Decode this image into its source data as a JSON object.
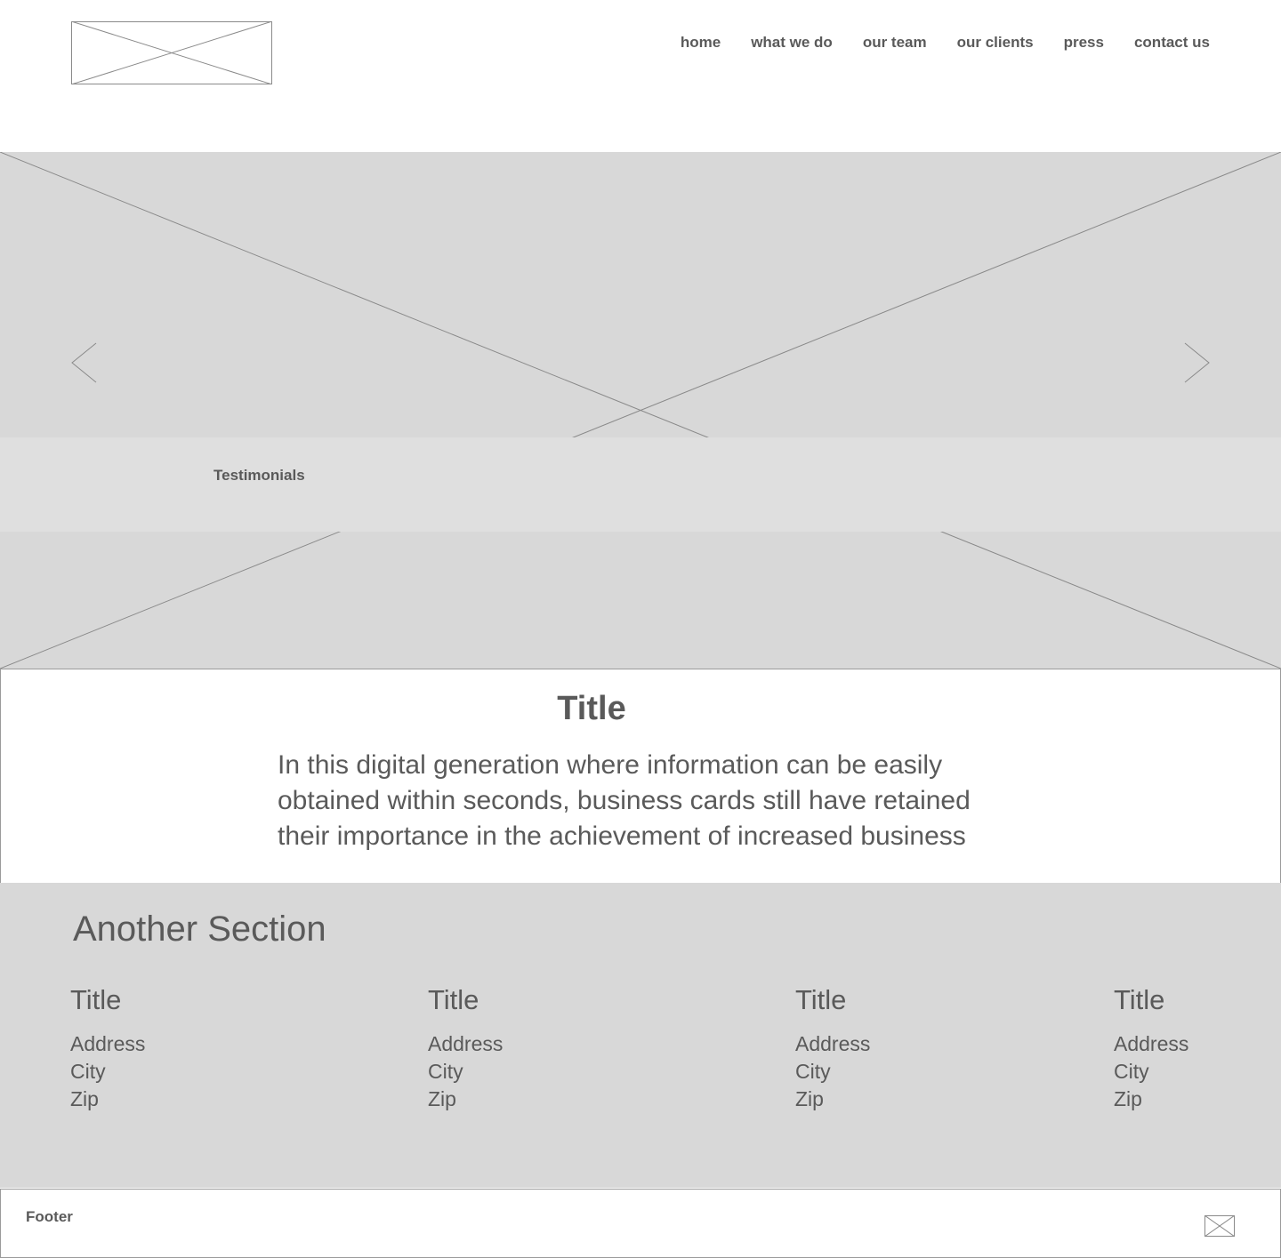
{
  "header": {
    "logo_icon": "image-placeholder-icon",
    "nav": [
      "home",
      "what we do",
      "our team",
      "our clients",
      "press",
      "contact us"
    ]
  },
  "hero": {
    "image_icon": "image-placeholder-icon",
    "prev_icon": "chevron-left-icon",
    "next_icon": "chevron-right-icon",
    "testimonials_label": "Testimonials"
  },
  "intro": {
    "title": "Title",
    "body": "In this digital generation where information can be easily obtained within seconds, business cards still have retained their importance in the achievement of increased business"
  },
  "section2": {
    "heading": "Another Section",
    "columns": [
      {
        "title": "Title",
        "address": "Address",
        "city": "City",
        "zip": "Zip"
      },
      {
        "title": "Title",
        "address": "Address",
        "city": "City",
        "zip": "Zip"
      },
      {
        "title": "Title",
        "address": "Address",
        "city": "City",
        "zip": "Zip"
      },
      {
        "title": "Title",
        "address": "Address",
        "city": "City",
        "zip": "Zip"
      }
    ]
  },
  "footer": {
    "label": "Footer",
    "image_icon": "image-placeholder-icon"
  },
  "colors": {
    "text": "#5a5a5a",
    "hero_bg": "#d8d8d8",
    "testimonials_bg": "#dfdfdf",
    "placeholder_line": "#8a8a8a"
  }
}
